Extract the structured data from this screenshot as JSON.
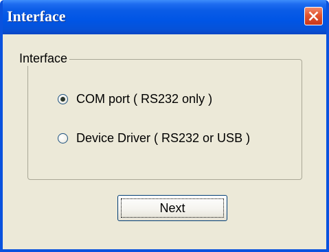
{
  "window": {
    "title": "Interface",
    "close_icon": "close-icon",
    "colors": {
      "titlebar": "#0055e5",
      "frame": "#0a52de",
      "client": "#ece9d8",
      "close_button": "#e2542f"
    }
  },
  "group": {
    "legend": "Interface"
  },
  "options": [
    {
      "label": "COM port ( RS232 only )",
      "selected": true
    },
    {
      "label": "Device Driver ( RS232 or USB )",
      "selected": false
    }
  ],
  "buttons": {
    "next_label": "Next"
  }
}
